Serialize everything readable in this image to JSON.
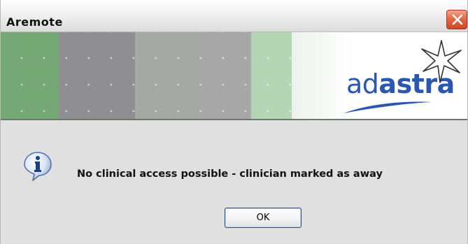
{
  "window": {
    "title": "Aremote",
    "close_icon": "close-icon"
  },
  "banner": {
    "logo_prefix": "ad",
    "logo_suffix": "astra",
    "logo_icon": "star-icon"
  },
  "dialog": {
    "icon": "info-icon",
    "message": "No clinical access possible - clinician marked as away",
    "ok_label": "OK"
  },
  "colors": {
    "brand_blue": "#2a58b0",
    "close_red": "#e26a48"
  }
}
